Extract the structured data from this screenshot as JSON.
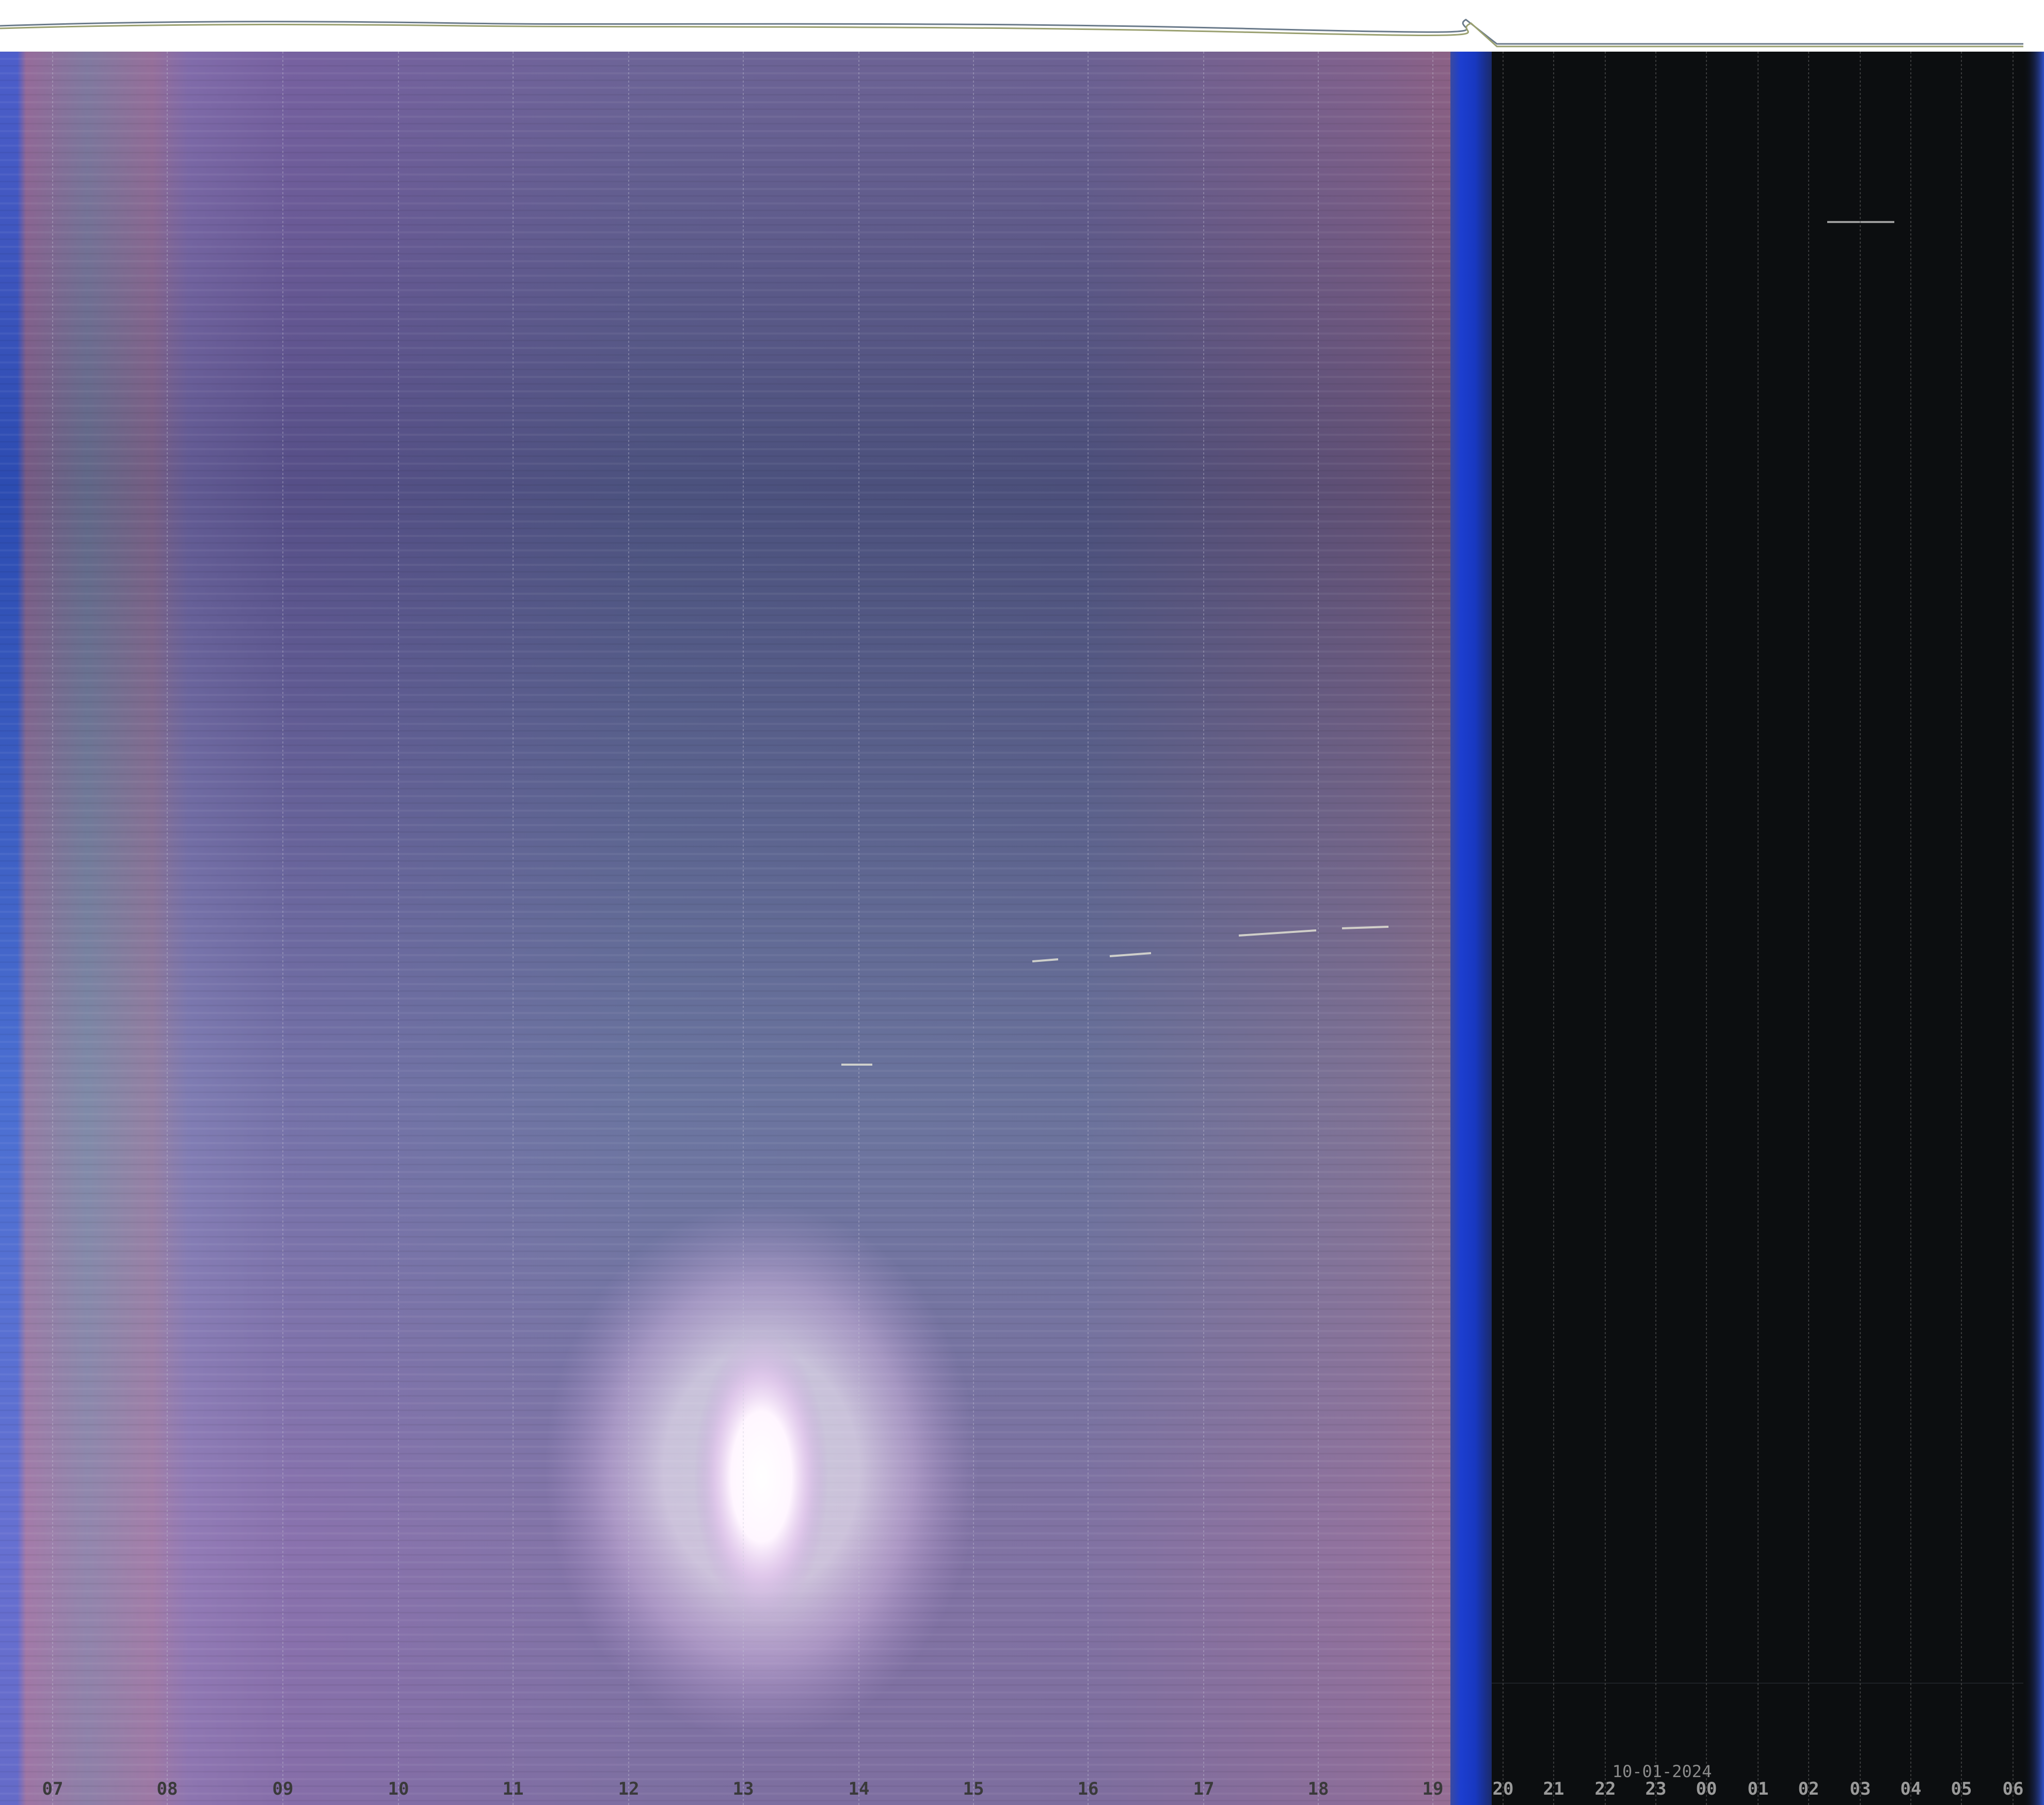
{
  "date_label": "10-01-2024",
  "hours": [
    {
      "label": "07",
      "color": "#3a3a3a"
    },
    {
      "label": "08",
      "color": "#3a3a3a"
    },
    {
      "label": "09",
      "color": "#3a3a3a"
    },
    {
      "label": "10",
      "color": "#3a3a3a"
    },
    {
      "label": "11",
      "color": "#3a3a3a"
    },
    {
      "label": "12",
      "color": "#3a3a3a"
    },
    {
      "label": "13",
      "color": "#3a3a3a"
    },
    {
      "label": "14",
      "color": "#3a3a3a"
    },
    {
      "label": "15",
      "color": "#3a3a3a"
    },
    {
      "label": "16",
      "color": "#3a3a3a"
    },
    {
      "label": "17",
      "color": "#3a3a3a"
    },
    {
      "label": "18",
      "color": "#3a3a3a"
    },
    {
      "label": "19",
      "color": "#3a3a3a"
    },
    {
      "label": "20",
      "color": "#9a9a9a"
    },
    {
      "label": "21",
      "color": "#9a9a9a"
    },
    {
      "label": "22",
      "color": "#9a9a9a"
    },
    {
      "label": "23",
      "color": "#9a9a9a"
    },
    {
      "label": "00",
      "color": "#9a9a9a"
    },
    {
      "label": "01",
      "color": "#9a9a9a"
    },
    {
      "label": "02",
      "color": "#9a9a9a"
    },
    {
      "label": "03",
      "color": "#9a9a9a"
    },
    {
      "label": "04",
      "color": "#9a9a9a"
    },
    {
      "label": "05",
      "color": "#9a9a9a"
    },
    {
      "label": "06",
      "color": "#9a9a9a"
    }
  ],
  "colors": {
    "day_sky": "#4a5680",
    "day_edge": "#8a6aa6",
    "twilight_blue": "#1f3fc4",
    "night_sky": "#0c0e10",
    "sun_glow": "#ffffff",
    "header_bg": "#ffffff"
  }
}
